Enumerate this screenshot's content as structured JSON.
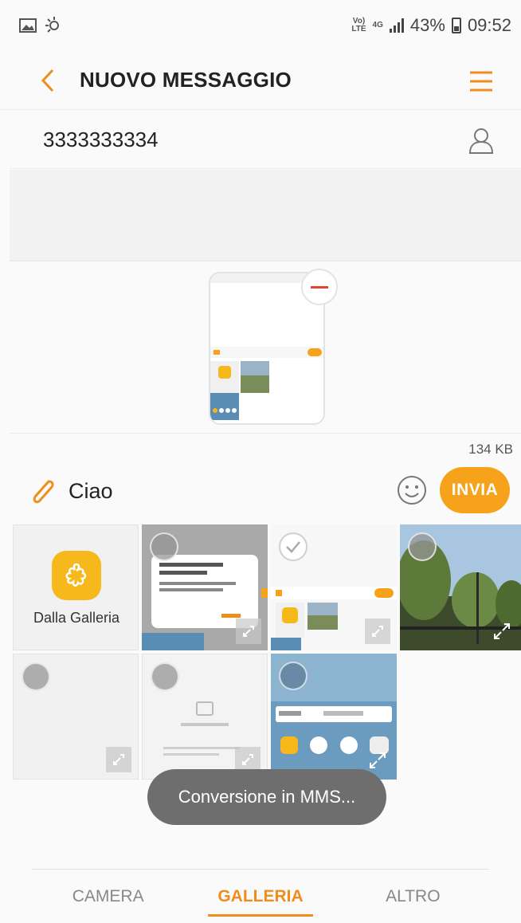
{
  "status_bar": {
    "network_top": "Vo)",
    "network_bottom": "LTE",
    "data_top": "4G",
    "battery": "43%",
    "time": "09:52"
  },
  "header": {
    "title": "NUOVO MESSAGGIO",
    "back_icon": "chevron-left-icon",
    "menu_icon": "hamburger-menu-icon"
  },
  "recipient": {
    "number": "3333333334",
    "contact_icon": "contact-person-icon"
  },
  "attachment": {
    "size": "134 KB"
  },
  "compose": {
    "text": "Ciao",
    "send_label": "INVIA"
  },
  "gallery": {
    "from_gallery_label": "Dalla Galleria"
  },
  "toast": {
    "text": "Conversione in MMS..."
  },
  "tabs": [
    {
      "label": "CAMERA"
    },
    {
      "label": "GALLERIA"
    },
    {
      "label": "ALTRO"
    }
  ],
  "colors": {
    "accent": "#f7a21b",
    "tab_active": "#ef8d1d",
    "remove": "#e3462f"
  }
}
